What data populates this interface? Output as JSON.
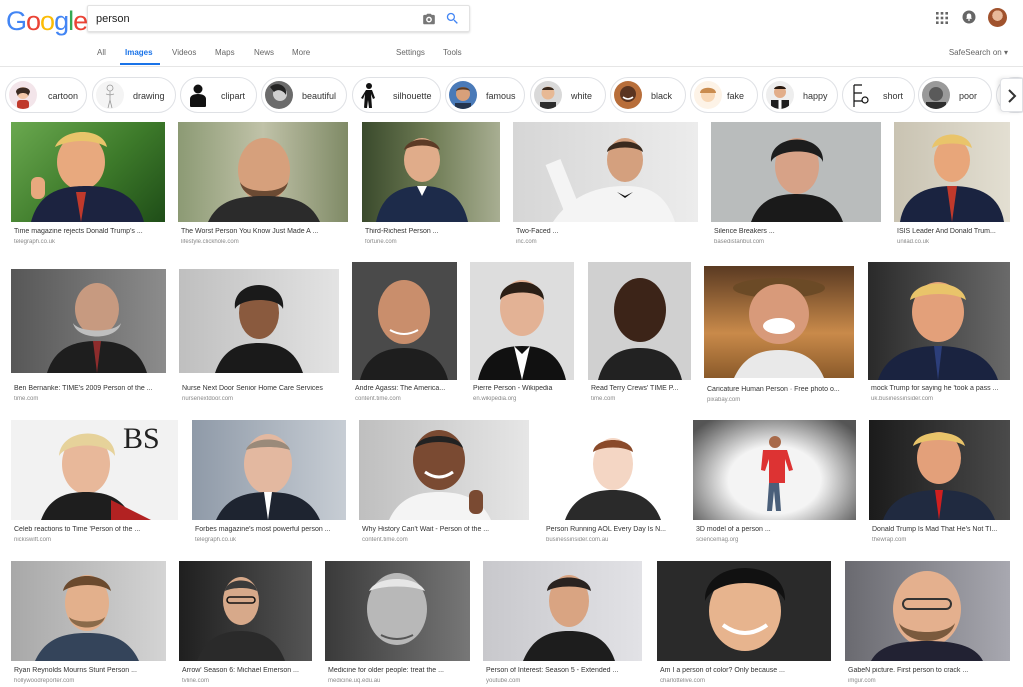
{
  "logo": {
    "letters": [
      "G",
      "o",
      "o",
      "g",
      "l",
      "e"
    ],
    "colors": [
      "#4285F4",
      "#EA4335",
      "#FBBC05",
      "#4285F4",
      "#34A853",
      "#EA4335"
    ]
  },
  "search": {
    "value": "person"
  },
  "nav": {
    "all": "All",
    "images": "Images",
    "videos": "Videos",
    "maps": "Maps",
    "news": "News",
    "more": "More",
    "settings": "Settings",
    "tools": "Tools",
    "safesearch": "SafeSearch on ▾"
  },
  "accent": "#1a73e8",
  "chips": [
    {
      "label": "cartoon"
    },
    {
      "label": "drawing"
    },
    {
      "label": "clipart"
    },
    {
      "label": "beautiful"
    },
    {
      "label": "silhouette"
    },
    {
      "label": "famous"
    },
    {
      "label": "white"
    },
    {
      "label": "black"
    },
    {
      "label": "fake"
    },
    {
      "label": "happy"
    },
    {
      "label": "short"
    },
    {
      "label": "poor"
    }
  ],
  "results": [
    {
      "title": "Time magazine rejects Donald Trump's ...",
      "source": "telegraph.co.uk"
    },
    {
      "title": "The Worst Person You Know Just Made A ...",
      "source": "lifestyle.clickhole.com"
    },
    {
      "title": "Third-Richest Person ...",
      "source": "fortune.com"
    },
    {
      "title": "Two-Faced ...",
      "source": "inc.com"
    },
    {
      "title": "Silence Breakers ...",
      "source": "basedistanbul.com"
    },
    {
      "title": "ISIS Leader And Donald Trum...",
      "source": "unilad.co.uk"
    },
    {
      "title": "Ben Bernanke: TIME's 2009 Person of the ...",
      "source": "time.com"
    },
    {
      "title": "Nurse Next Door Senior Home Care Services",
      "source": "nursenextdoor.com"
    },
    {
      "title": "Andre Agassi: The America...",
      "source": "content.time.com"
    },
    {
      "title": "Pierre Person - Wikipedia",
      "source": "en.wikipedia.org"
    },
    {
      "title": "Read Terry Crews' TIME P...",
      "source": "time.com"
    },
    {
      "title": "Caricature Human Person · Free photo o...",
      "source": "pixabay.com"
    },
    {
      "title": "mock Trump for saying he 'took a pass ...",
      "source": "uk.businessinsider.com"
    },
    {
      "title": "Celeb reactions to Time 'Person of the ...",
      "source": "nickiswift.com"
    },
    {
      "title": "Forbes magazine's most powerful person ...",
      "source": "telegraph.co.uk"
    },
    {
      "title": "Why History Can't Wait - Person of the ...",
      "source": "content.time.com"
    },
    {
      "title": "Person Running AOL Every Day Is N...",
      "source": "businessinsider.com.au"
    },
    {
      "title": "3D model of a person ...",
      "source": "sciencemag.org"
    },
    {
      "title": "Donald Trump Is Mad That He's Not TI...",
      "source": "thewrap.com"
    },
    {
      "title": "Ryan Reynolds Mourns Stunt Person ...",
      "source": "hollywoodreporter.com"
    },
    {
      "title": "Arrow' Season 6: Michael Emerson ...",
      "source": "tvline.com"
    },
    {
      "title": "Medicine for older people: treat the ...",
      "source": "medicine.uq.edu.au"
    },
    {
      "title": "Person of Interest: Season 5 - Extended ...",
      "source": "youtube.com"
    },
    {
      "title": "Am I a person of color? Only because ...",
      "source": "charlottelive.com"
    },
    {
      "title": "GabeN picture. First person to crack ...",
      "source": "imgur.com"
    }
  ]
}
